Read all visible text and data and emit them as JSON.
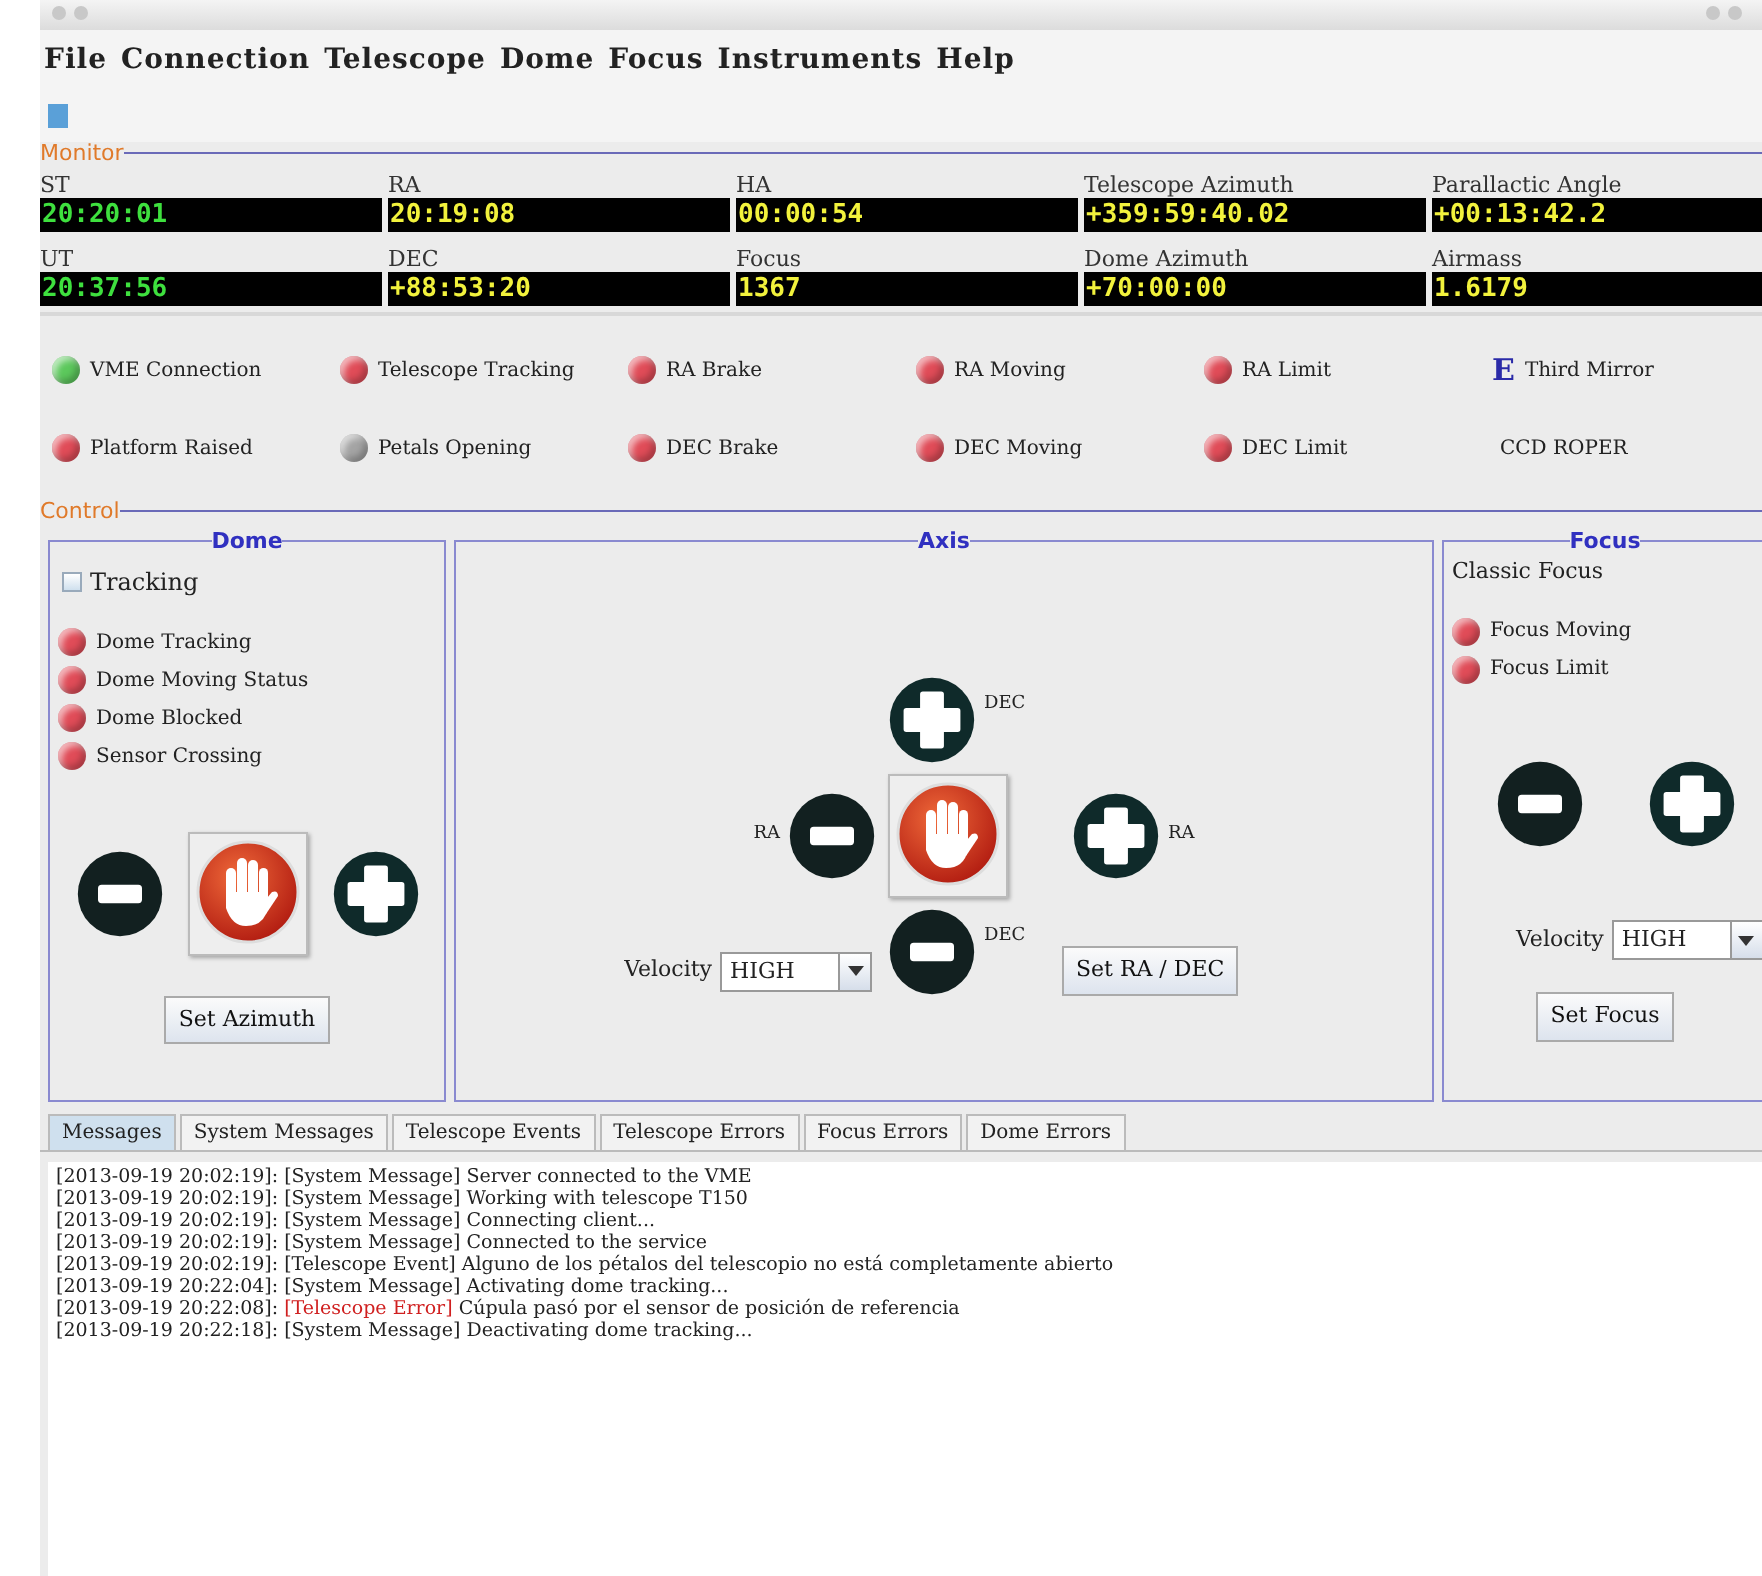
{
  "menu": [
    "File",
    "Connection",
    "Telescope",
    "Dome",
    "Focus",
    "Instruments",
    "Help"
  ],
  "monitor": {
    "title": "Monitor",
    "fields": [
      {
        "label": "ST",
        "value": "20:20:01",
        "kind": "clock"
      },
      {
        "label": "RA",
        "value": "20:19:08",
        "kind": "position"
      },
      {
        "label": "HA",
        "value": "00:00:54",
        "kind": "position"
      },
      {
        "label": "Telescope Azimuth",
        "value": "+359:59:40.02",
        "kind": "position"
      },
      {
        "label": "Parallactic Angle",
        "value": "+00:13:42.2",
        "kind": "position"
      },
      {
        "label": "UT",
        "value": "20:37:56",
        "kind": "clock"
      },
      {
        "label": "DEC",
        "value": "+88:53:20",
        "kind": "position"
      },
      {
        "label": "Focus",
        "value": "1367",
        "kind": "position"
      },
      {
        "label": "Dome Azimuth",
        "value": "+70:00:00",
        "kind": "position"
      },
      {
        "label": "Airmass",
        "value": "1.6179",
        "kind": "position"
      }
    ],
    "indicators": [
      {
        "kind": "led",
        "label": "VME Connection",
        "color": "#5cc85c"
      },
      {
        "kind": "led",
        "label": "Telescope Tracking",
        "color": "#e04c58"
      },
      {
        "kind": "led",
        "label": "RA Brake",
        "color": "#e04c58"
      },
      {
        "kind": "led",
        "label": "RA Moving",
        "color": "#e04c58"
      },
      {
        "kind": "led",
        "label": "RA Limit",
        "color": "#e04c58"
      },
      {
        "kind": "letter",
        "symbol": "E",
        "label": "Third Mirror"
      },
      {
        "kind": "led",
        "label": "Platform Raised",
        "color": "#e04c58"
      },
      {
        "kind": "led",
        "label": "Petals Opening",
        "color": "#a4a4a4"
      },
      {
        "kind": "led",
        "label": "DEC Brake",
        "color": "#e04c58"
      },
      {
        "kind": "led",
        "label": "DEC Moving",
        "color": "#e04c58"
      },
      {
        "kind": "led",
        "label": "DEC Limit",
        "color": "#e04c58"
      },
      {
        "kind": "text",
        "label": "CCD ROPER"
      }
    ]
  },
  "control": {
    "title": "Control",
    "dome": {
      "title": "Dome",
      "tracking": {
        "label": "Tracking",
        "checked": false
      },
      "indicators": [
        {
          "label": "Dome Tracking",
          "color": "#e04c58"
        },
        {
          "label": "Dome Moving Status",
          "color": "#e04c58"
        },
        {
          "label": "Dome Blocked",
          "color": "#e04c58"
        },
        {
          "label": "Sensor Crossing",
          "color": "#e04c58"
        }
      ],
      "set_button": "Set Azimuth"
    },
    "axis": {
      "title": "Axis",
      "dec_plus_label": "DEC",
      "ra_minus_label": "RA",
      "ra_plus_label": "RA",
      "dec_minus_label": "DEC",
      "velocity_label": "Velocity",
      "velocity": "HIGH",
      "set_button": "Set RA / DEC"
    },
    "focus": {
      "title": "Focus",
      "subtitle": "Classic Focus",
      "indicators": [
        {
          "label": "Focus Moving",
          "color": "#e04c58"
        },
        {
          "label": "Focus Limit",
          "color": "#e04c58"
        }
      ],
      "velocity_label": "Velocity",
      "velocity": "HIGH",
      "set_button": "Set Focus"
    }
  },
  "tabs": [
    {
      "label": "Messages",
      "selected": true
    },
    {
      "label": "System Messages",
      "selected": false
    },
    {
      "label": "Telescope Events",
      "selected": false
    },
    {
      "label": "Telescope Errors",
      "selected": false
    },
    {
      "label": "Focus Errors",
      "selected": false
    },
    {
      "label": "Dome Errors",
      "selected": false
    }
  ],
  "log": [
    {
      "kind": "normal",
      "time": "[2013-09-19 20:02:19]:",
      "tag": "[System Message]",
      "text": "Server connected to the VME"
    },
    {
      "kind": "normal",
      "time": "[2013-09-19 20:02:19]:",
      "tag": "[System Message]",
      "text": "Working with telescope T150"
    },
    {
      "kind": "normal",
      "time": "[2013-09-19 20:02:19]:",
      "tag": "[System Message]",
      "text": "Connecting client..."
    },
    {
      "kind": "normal",
      "time": "[2013-09-19 20:02:19]:",
      "tag": "[System Message]",
      "text": "Connected to the service"
    },
    {
      "kind": "normal",
      "time": "[2013-09-19 20:02:19]:",
      "tag": "[Telescope Event]",
      "text": "Alguno de los pétalos del telescopio no está completamente abierto"
    },
    {
      "kind": "normal",
      "time": "[2013-09-19 20:22:04]:",
      "tag": "[System Message]",
      "text": "Activating dome tracking..."
    },
    {
      "kind": "error",
      "time": "[2013-09-19 20:22:08]:",
      "tag": "[Telescope Error]",
      "text": "Cúpula pasó por el sensor de posición de referencia"
    },
    {
      "kind": "normal",
      "time": "[2013-09-19 20:22:18]:",
      "tag": "[System Message]",
      "text": "Deactivating dome tracking..."
    }
  ]
}
